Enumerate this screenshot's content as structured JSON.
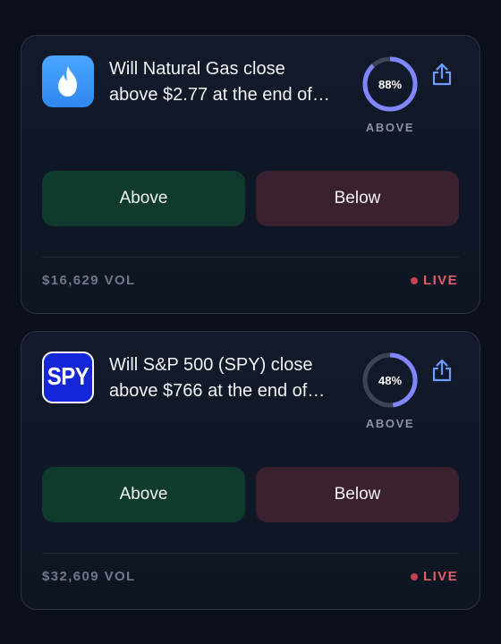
{
  "theme": {
    "background": "#0b101c",
    "above_button_color": "#0f3a2e",
    "below_button_color": "#3b2030",
    "gauge_accent": "#7f86ff",
    "gauge_track": "#3d4455",
    "live_color": "#e15c66"
  },
  "markets": [
    {
      "icon": "flame-icon",
      "icon_bg": "#3b93f8",
      "question_line1": "Will Natural Gas close",
      "question_line2": "above $2.77 at the end of…",
      "probability": 88,
      "probability_label": "88%",
      "gauge_caption": "ABOVE",
      "above_label": "Above",
      "below_label": "Below",
      "volume": "$16,629 VOL",
      "status": "LIVE"
    },
    {
      "icon": "spy-logo-icon",
      "icon_text": "SPY",
      "icon_bg": "#1327d8",
      "question_line1": "Will S&P 500 (SPY) close",
      "question_line2": "above $766 at the end of…",
      "probability": 48,
      "probability_label": "48%",
      "gauge_caption": "ABOVE",
      "above_label": "Above",
      "below_label": "Below",
      "volume": "$32,609 VOL",
      "status": "LIVE"
    }
  ]
}
